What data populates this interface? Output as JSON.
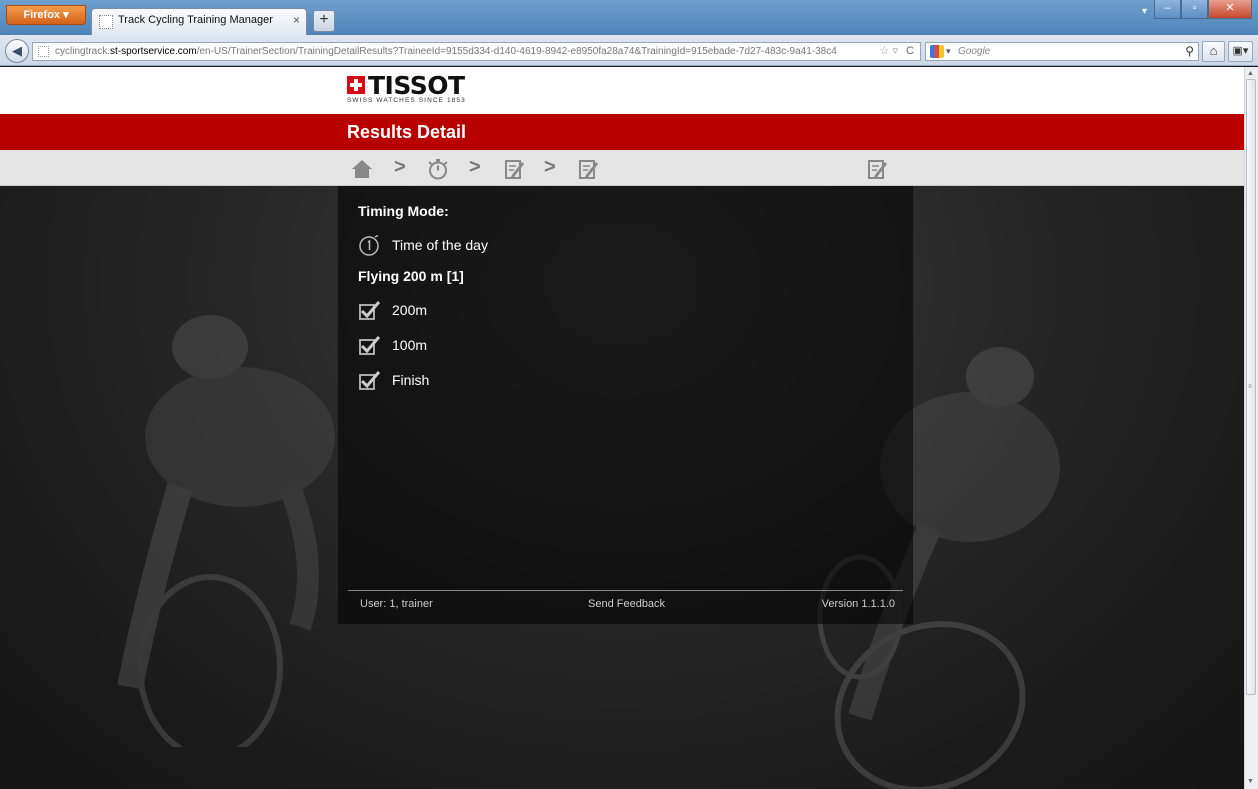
{
  "browser": {
    "menu_button": "Firefox",
    "tab_title": "Track Cycling Training Manager",
    "tab_close": "×",
    "new_tab": "+",
    "tab_list": "▾",
    "window_minimize": "‒",
    "window_maximize": "▫",
    "window_close": "✕",
    "back": "◀",
    "url_prefix": "cyclingtrack.",
    "url_domain": "st-sportservice.com",
    "url_path": "/en-US/TrainerSection/TrainingDetailResults?TraineeId=9155d334-d140-4619-8942-e8950fa28a74&TrainingId=915ebade-7d27-483c-9a41-38c4",
    "bookmark_star": "☆ ▿",
    "reload": "C",
    "search_placeholder": "Google",
    "search_engine_arrow": "▾",
    "search_button": "⚲",
    "home": "⌂",
    "addon": "▣▾"
  },
  "scrollbar": {
    "up": "▲",
    "down": "▼",
    "grip": "≡"
  },
  "logo": {
    "brand": "TISSOT",
    "tagline": "SWISS WATCHES SINCE 1853"
  },
  "page": {
    "title": "Results Detail"
  },
  "breadcrumb": {
    "separators": [
      ">",
      ">",
      ">"
    ]
  },
  "panel": {
    "timing_mode_heading": "Timing Mode:",
    "timing_mode_value": "Time of the day",
    "section_heading": "Flying 200 m [1]",
    "checkpoints": [
      "200m",
      "100m",
      "Finish"
    ]
  },
  "footer": {
    "user": "User: 1, trainer",
    "feedback": "Send Feedback",
    "version": "Version 1.1.1.0"
  },
  "colors": {
    "header_red": "#b90000",
    "brand_red": "#d70a16"
  },
  "icons": {
    "home": "home-icon",
    "stopwatch": "stopwatch-icon",
    "edit": "edit-note-icon",
    "timer": "timer-icon",
    "checkbox": "checkbox-checked-icon"
  }
}
